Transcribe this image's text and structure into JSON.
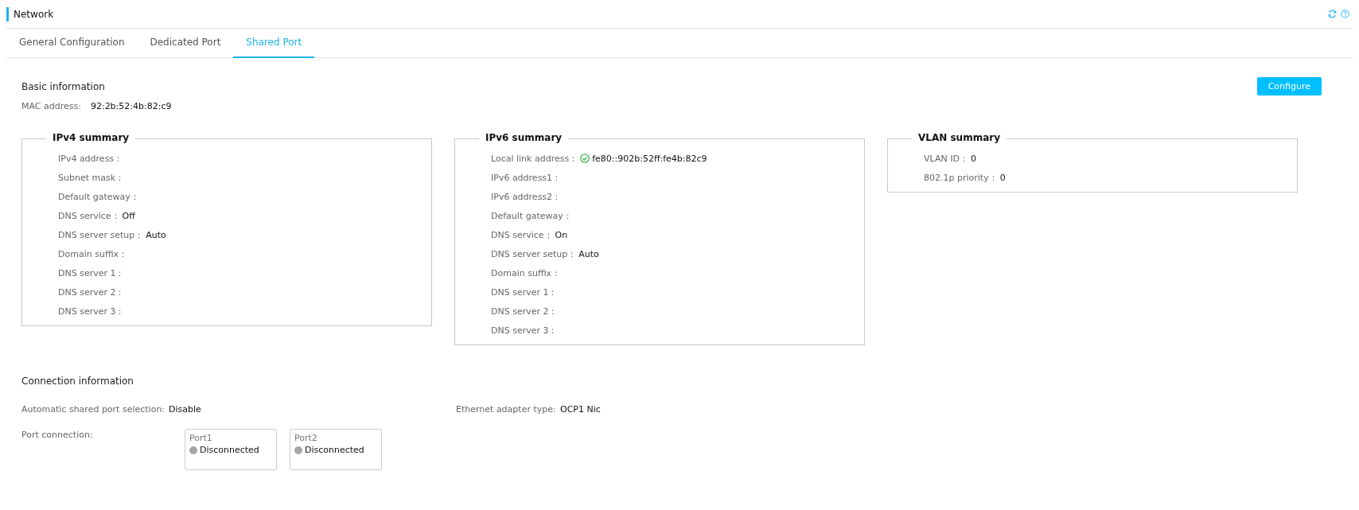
{
  "page": {
    "title": "Network"
  },
  "tabs": [
    {
      "label": "General Configuration",
      "selected": false
    },
    {
      "label": "Dedicated Port",
      "selected": false
    },
    {
      "label": "Shared Port",
      "selected": true
    }
  ],
  "basic": {
    "heading": "Basic information",
    "button": "Configure",
    "mac_label": "MAC address:",
    "mac_value": "92:2b:52:4b:82:c9"
  },
  "summaries": [
    {
      "title": "IPv4 summary",
      "rows": [
        {
          "label": "IPv4 address：",
          "kind": "plain"
        },
        {
          "label": "Subnet mask：",
          "kind": "plain"
        },
        {
          "label": "Default gateway：",
          "kind": "plain"
        },
        {
          "label": "DNS service：",
          "value": "Off",
          "kind": "plain"
        },
        {
          "label": "DNS server setup：",
          "value": "Auto",
          "kind": "plain"
        },
        {
          "label": "Domain suffix：",
          "kind": "plain"
        },
        {
          "label": "DNS server 1：",
          "kind": "plain"
        },
        {
          "label": "DNS server 2：",
          "kind": "plain"
        },
        {
          "label": "DNS server 3：",
          "kind": "plain"
        }
      ]
    },
    {
      "title": "IPv6 summary",
      "rows": [
        {
          "label": "Local link address：",
          "value": "fe80::902b:52ff:fe4b:82c9",
          "kind": "verified"
        },
        {
          "label": "IPv6 address1：",
          "kind": "plain"
        },
        {
          "label": "IPv6 address2：",
          "kind": "plain"
        },
        {
          "label": "Default gateway：",
          "kind": "plain"
        },
        {
          "label": "DNS service：",
          "value": "On",
          "kind": "plain"
        },
        {
          "label": "DNS server setup：",
          "value": "Auto",
          "kind": "plain"
        },
        {
          "label": "Domain suffix：",
          "kind": "plain"
        },
        {
          "label": "DNS server 1：",
          "kind": "plain"
        },
        {
          "label": "DNS server 2：",
          "kind": "plain"
        },
        {
          "label": "DNS server 3：",
          "kind": "plain"
        }
      ]
    },
    {
      "title": "VLAN summary",
      "rows": [
        {
          "label": "VLAN ID：",
          "value": "0",
          "kind": "plain"
        },
        {
          "label": "802.1p priority：",
          "value": "0",
          "kind": "plain"
        }
      ]
    }
  ],
  "connection": {
    "heading": "Connection information",
    "auto_label": "Automatic shared port selection:",
    "auto_value": "Disable",
    "adapter_label": "Ethernet adapter type:",
    "adapter_value": "OCP1 Nic",
    "ports_label": "Port connection:",
    "ports": [
      {
        "name": "Port1",
        "status": "Disconnected",
        "connected": false
      },
      {
        "name": "Port2",
        "status": "Disconnected",
        "connected": false
      }
    ]
  }
}
